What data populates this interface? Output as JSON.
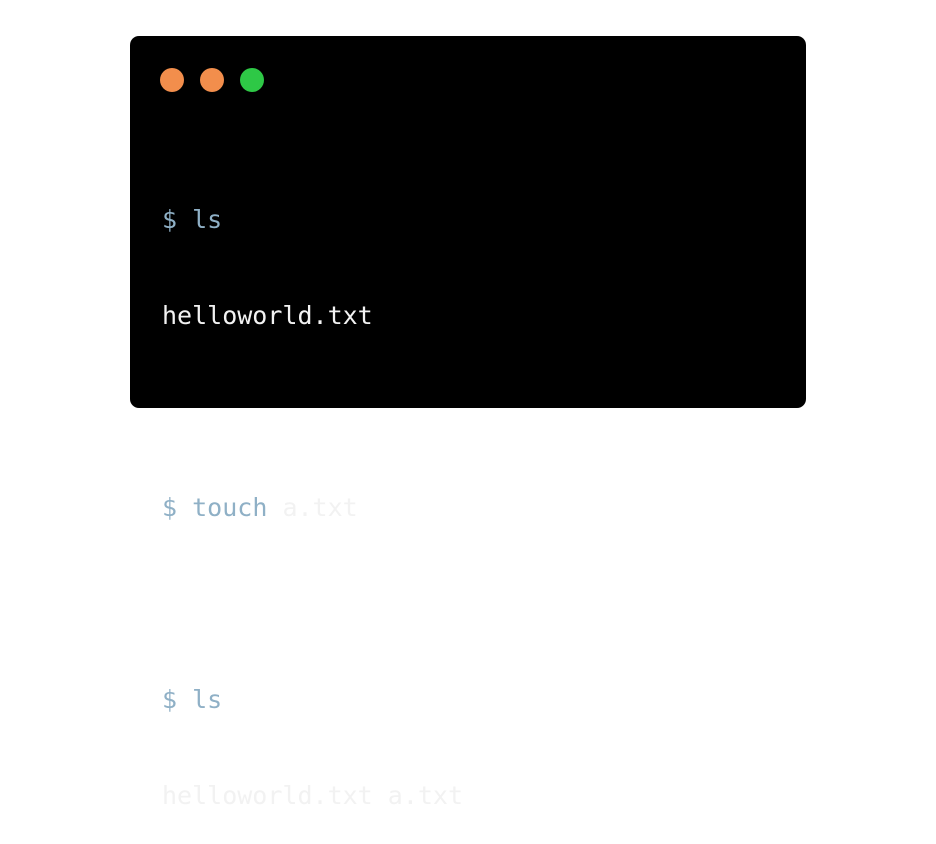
{
  "window": {
    "controls": [
      {
        "name": "close-dot",
        "color": "#f28e4c"
      },
      {
        "name": "minimize-dot",
        "color": "#f28e4c"
      },
      {
        "name": "maximize-dot",
        "color": "#2ec846"
      }
    ]
  },
  "terminal": {
    "lines": [
      {
        "type": "command",
        "prompt": "$",
        "command": "ls",
        "args": ""
      },
      {
        "type": "output",
        "text": "helloworld.txt"
      },
      {
        "type": "blank"
      },
      {
        "type": "command",
        "prompt": "$",
        "command": "touch",
        "args": "a.txt"
      },
      {
        "type": "blank"
      },
      {
        "type": "command",
        "prompt": "$",
        "command": "ls",
        "args": ""
      },
      {
        "type": "output",
        "text": "helloworld.txt a.txt"
      }
    ]
  },
  "colors": {
    "terminal_bg": "#000000",
    "prompt_color": "#8fb0c6",
    "text_color": "#f2f2f2"
  }
}
